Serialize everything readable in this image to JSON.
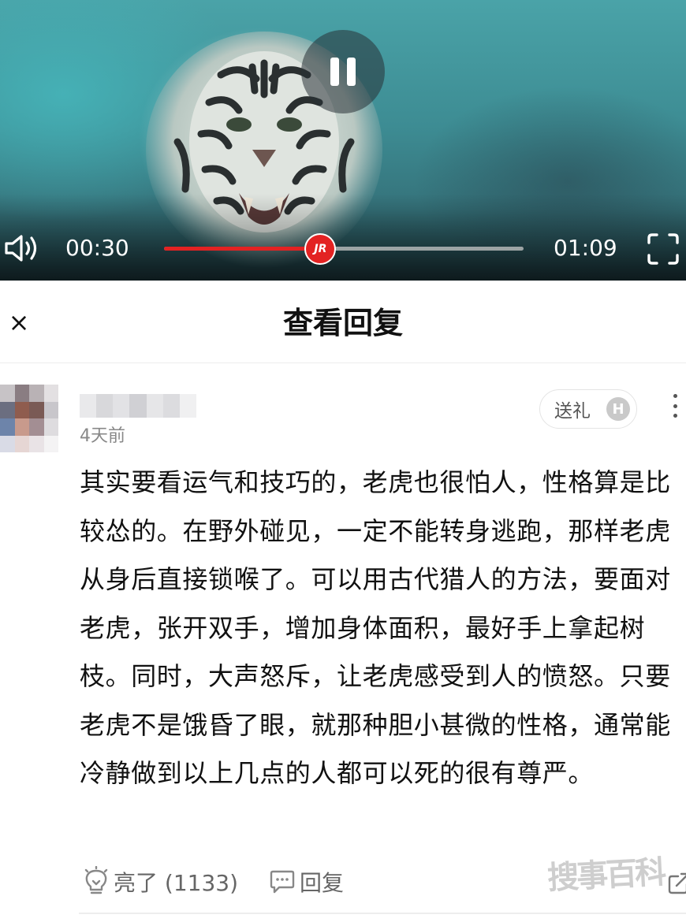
{
  "player": {
    "current_time": "00:30",
    "duration": "01:09",
    "progress": 0.435,
    "thumb_label": "JR",
    "state": "playing",
    "accent_color": "#e32222",
    "icons": {
      "pause": "pause-icon",
      "volume": "volume-icon",
      "fullscreen": "fullscreen-icon"
    }
  },
  "sheet": {
    "title": "查看回复",
    "close_label": "×"
  },
  "comment": {
    "time_ago": "4天前",
    "gift_label": "送礼",
    "gift_badge": "H",
    "body": "其实要看运气和技巧的，老虎也很怕人，性格算是比较怂的。在野外碰见，一定不能转身逃跑，那样老虎从身后直接锁喉了。可以用古代猎人的方法，要面对老虎，张开双手，增加身体面积，最好手上拿起树枝。同时，大声怒斥，让老虎感受到人的愤怒。只要老虎不是饿昏了眼，就那种胆小甚微的性格，通常能冷静做到以上几点的人都可以死的很有尊严。",
    "like_label": "亮了 (1133)",
    "reply_label": "回复"
  },
  "watermark": {
    "text": "搜事百科"
  }
}
